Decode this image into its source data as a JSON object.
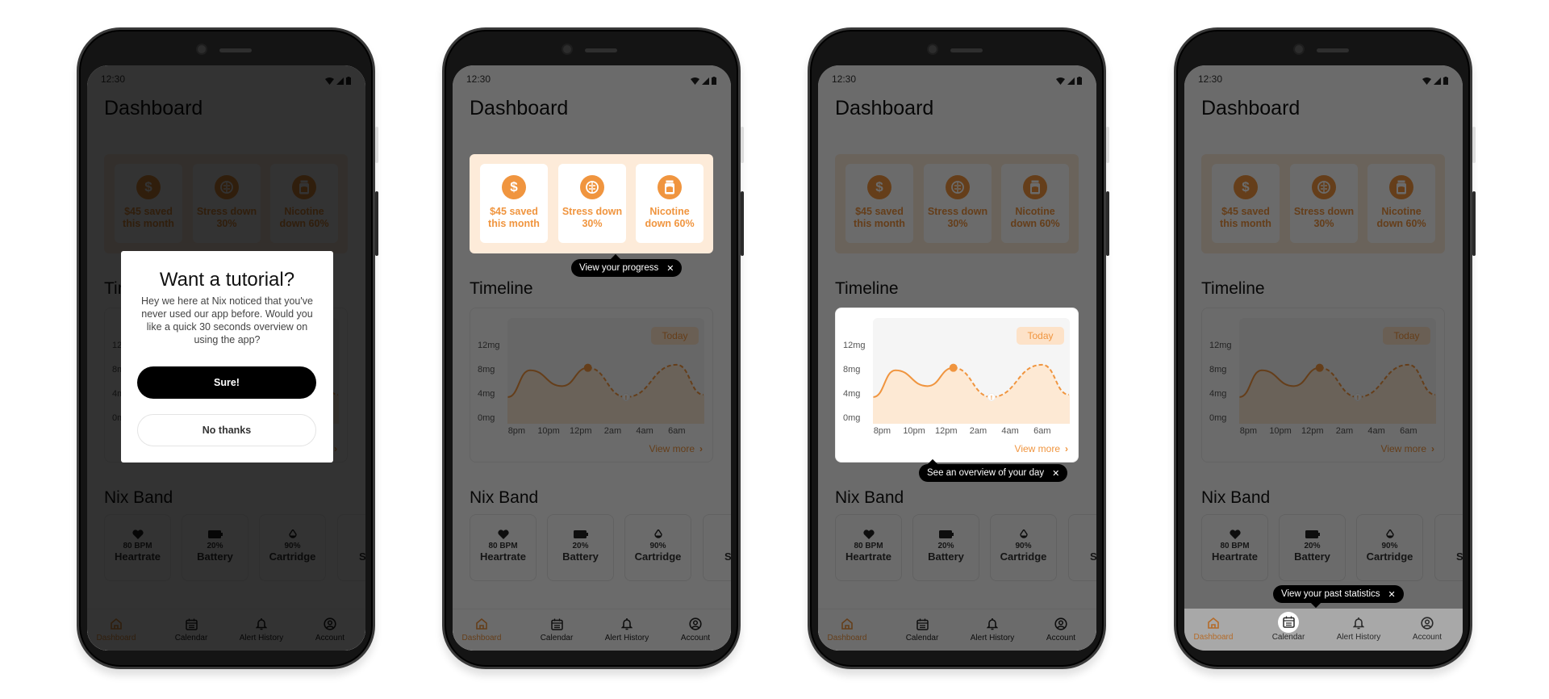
{
  "colors": {
    "accent": "#f0953f",
    "panel": "#fdebd9",
    "tooltip": "#000000",
    "plot_bg": "#f5f5f5",
    "area_fill": "#fde9d4"
  },
  "app": {
    "status_time": "12:30",
    "status_icons": [
      "wifi-icon",
      "signal-icon",
      "battery-icon"
    ],
    "title": "Dashboard",
    "stats": [
      {
        "icon": "dollar-icon",
        "label": "$45 saved this month"
      },
      {
        "icon": "brain-icon",
        "label": "Stress down 30%"
      },
      {
        "icon": "jar-icon",
        "label": "Nicotine down 60%"
      }
    ],
    "timeline_title": "Timeline",
    "today_label": "Today",
    "view_more": "View more",
    "band_title": "Nix Band",
    "band": [
      {
        "icon": "heart-icon",
        "value": "80 BPM",
        "label": "Heartrate"
      },
      {
        "icon": "battery-icon",
        "value": "20%",
        "label": "Battery"
      },
      {
        "icon": "droplet-icon",
        "value": "90%",
        "label": "Cartridge"
      },
      {
        "icon": "",
        "value": "",
        "label": "S"
      }
    ],
    "nav": [
      {
        "icon": "home-icon",
        "label": "Dashboard",
        "active": true
      },
      {
        "icon": "calendar-icon",
        "label": "Calendar",
        "active": false
      },
      {
        "icon": "bell-icon",
        "label": "Alert History",
        "active": false
      },
      {
        "icon": "account-icon",
        "label": "Account",
        "active": false
      }
    ]
  },
  "chart_data": {
    "type": "area",
    "y_ticks": [
      "12mg",
      "8mg",
      "4mg",
      "0mg"
    ],
    "y_tick_values": [
      12,
      8,
      4,
      0
    ],
    "x_ticks": [
      "8pm",
      "10pm",
      "12pm",
      "2am",
      "4am",
      "6am"
    ],
    "x_tick_times": [
      "20:00",
      "22:00",
      "00:00",
      "02:00",
      "04:00",
      "06:00"
    ],
    "ylim": [
      0,
      12
    ],
    "actual": [
      {
        "t": "19:27",
        "mg": 3.6
      },
      {
        "t": "20:50",
        "mg": 8.0
      },
      {
        "t": "22:50",
        "mg": 5.4
      },
      {
        "t": "00:27",
        "mg": 8.4
      }
    ],
    "projected": [
      {
        "t": "00:27",
        "mg": 8.4
      },
      {
        "t": "02:50",
        "mg": 3.6
      },
      {
        "t": "06:00",
        "mg": 8.9
      },
      {
        "t": "07:40",
        "mg": 4.0
      }
    ],
    "current_point": {
      "t": "00:27",
      "mg": 8.4
    },
    "alert_point": {
      "t": "02:50",
      "mg": 3.6,
      "label": "!"
    }
  },
  "modal": {
    "title": "Want a tutorial?",
    "body": "Hey we here at Nix noticed that you've never used our app before. Would you like a quick 30 seconds overview on using the app?",
    "confirm": "Sure!",
    "decline": "No thanks"
  },
  "phones": [
    {
      "mode": "modal",
      "highlight": "",
      "tooltip": ""
    },
    {
      "mode": "tip",
      "highlight": "stats",
      "tooltip": "View your progress"
    },
    {
      "mode": "tip",
      "highlight": "chart",
      "tooltip": "See an overview of your day"
    },
    {
      "mode": "tip",
      "highlight": "nav",
      "tooltip": "View your past statistics"
    }
  ],
  "close_glyph": "✕"
}
